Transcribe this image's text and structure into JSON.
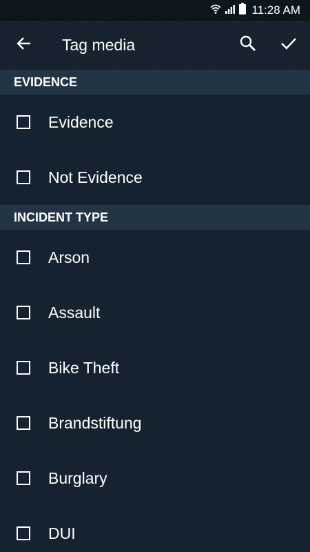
{
  "status_bar": {
    "time": "11:28 AM",
    "icons": [
      "wifi-icon",
      "signal-icon",
      "battery-icon"
    ]
  },
  "app_bar": {
    "title": "Tag media",
    "back_icon": "arrow-left-icon",
    "search_icon": "search-icon",
    "done_icon": "check-icon"
  },
  "sections": [
    {
      "header": "EVIDENCE",
      "items": [
        {
          "label": "Evidence",
          "checked": false
        },
        {
          "label": "Not Evidence",
          "checked": false
        }
      ]
    },
    {
      "header": "INCIDENT TYPE",
      "items": [
        {
          "label": "Arson",
          "checked": false
        },
        {
          "label": "Assault",
          "checked": false
        },
        {
          "label": "Bike Theft",
          "checked": false
        },
        {
          "label": "Brandstiftung",
          "checked": false
        },
        {
          "label": "Burglary",
          "checked": false
        },
        {
          "label": "DUI",
          "checked": false
        }
      ]
    }
  ],
  "colors": {
    "background": "#152330",
    "section_header": "#233545",
    "status_bar": "#0d151d",
    "text": "#ffffff"
  }
}
